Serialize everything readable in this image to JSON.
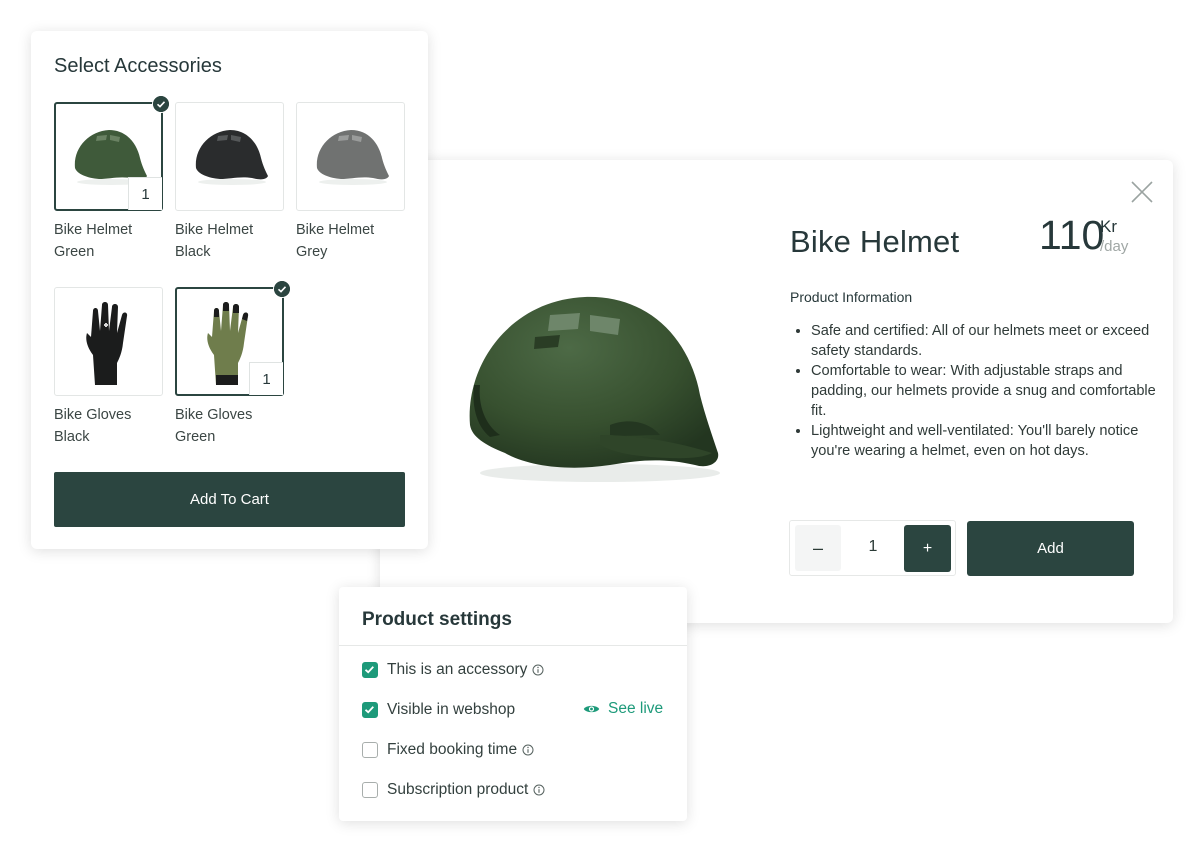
{
  "product": {
    "title": "Bike Helmet",
    "price_amount": "110",
    "price_currency": "Kr",
    "price_unit": "/day",
    "info_heading": "Product Information",
    "info_points": [
      "Safe and certified: All of our helmets meet or exceed safety standards.",
      "Comfortable to wear: With adjustable straps and padding, our helmets provide a snug and comfortable fit.",
      "Lightweight and well-ventilated: You'll barely notice you're wearing a helmet, even on hot days."
    ],
    "quantity": "1",
    "minus_label": "–",
    "plus_label": "+",
    "add_label": "Add"
  },
  "accessories": {
    "title": "Select Accessories",
    "items": [
      {
        "label": "Bike Helmet Green",
        "selected": true,
        "count": "1",
        "color": "#3f5a3a"
      },
      {
        "label": "Bike Helmet Black",
        "selected": false,
        "count": "",
        "color": "#2a2c2d"
      },
      {
        "label": "Bike Helmet Grey",
        "selected": false,
        "count": "",
        "color": "#707271"
      },
      {
        "label": "Bike Gloves Black",
        "selected": false,
        "count": "",
        "color": "#1b1c1c"
      },
      {
        "label": "Bike Gloves Green",
        "selected": true,
        "count": "1",
        "color": "#6f7d4c"
      }
    ],
    "add_to_cart_label": "Add To Cart"
  },
  "settings": {
    "title": "Product settings",
    "options": [
      {
        "label": "This is an accessory",
        "checked": true,
        "info": true
      },
      {
        "label": "Visible in webshop",
        "checked": true,
        "info": false
      },
      {
        "label": "Fixed booking time",
        "checked": false,
        "info": true
      },
      {
        "label": "Subscription product",
        "checked": false,
        "info": true
      }
    ],
    "see_live_label": "See live"
  },
  "colors": {
    "primary_dark": "#2b4540",
    "accent_green": "#1d9a7a",
    "helmet_green": "#3f5a3a"
  }
}
